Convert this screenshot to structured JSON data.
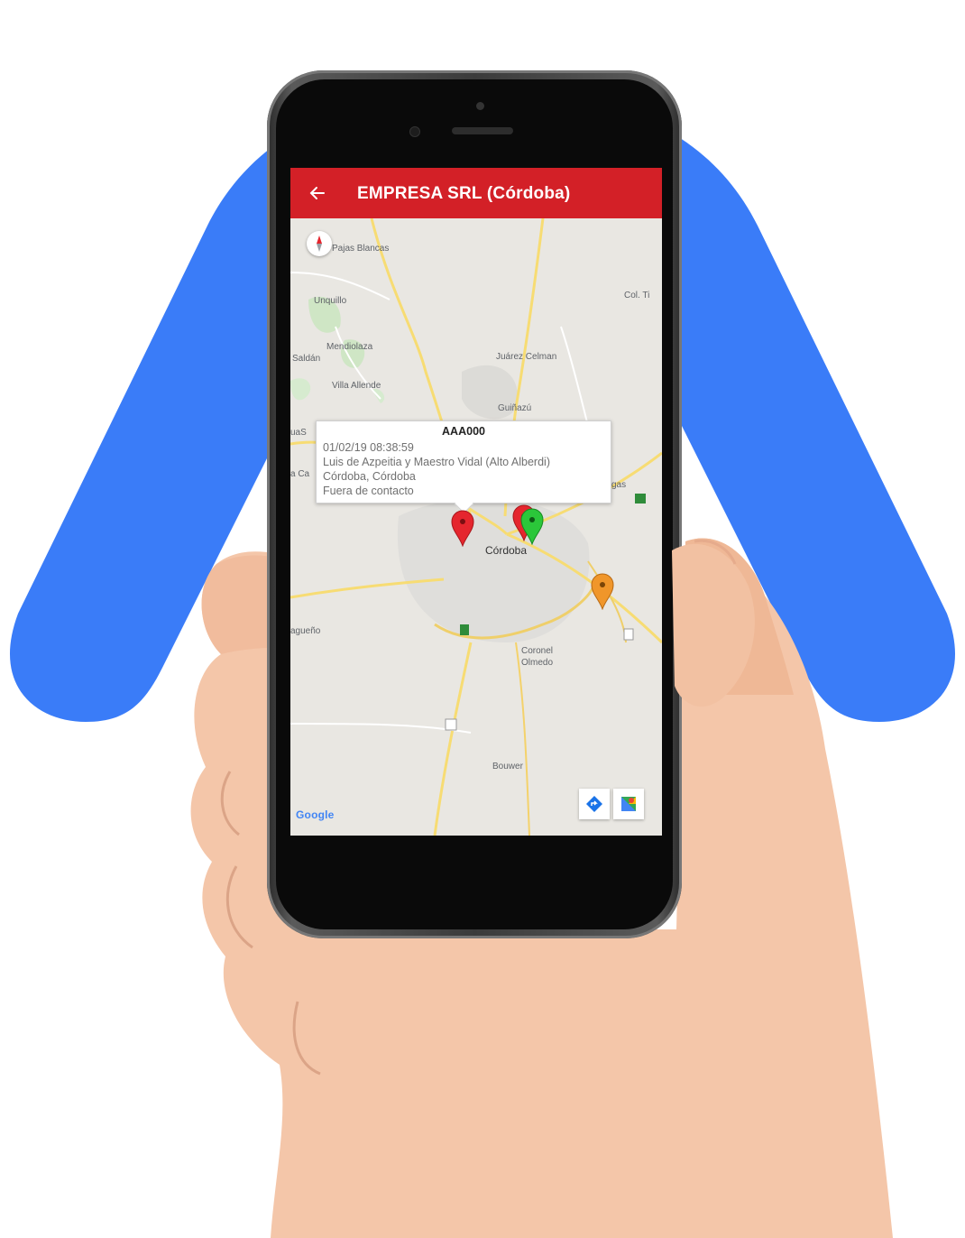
{
  "colors": {
    "brand_blue": "#3a7cf8",
    "app_bar": "#d32027",
    "map_bg": "#e9e7e2",
    "road_yellow": "#f7dc73",
    "pin_red": "#e5262e",
    "pin_green": "#2bc73a",
    "pin_orange": "#f0962a"
  },
  "app_bar": {
    "title": "EMPRESA SRL (Córdoba)",
    "back_icon": "arrow-left-icon"
  },
  "map": {
    "labels": {
      "pajas_blancas": "Pajas Blancas",
      "unquillo": "Unquillo",
      "col_tirolesa": "Col. Ti",
      "mendiolaza": "Mendiolaza",
      "saldan": "Saldán",
      "juarez_celman": "Juárez Celman",
      "villa_allende": "Villa Allende",
      "guinazu": "Guiñazú",
      "cordoba": "Córdoba",
      "coronel": "Coronel",
      "olmedo": "Olmedo",
      "bouwer": "Bouwer",
      "laguna": "agueño",
      "left_edge": "uaS",
      "left_edge2": "a Ca",
      "right_edge": "gas"
    },
    "info_window": {
      "title": "AAA000",
      "line1": "01/02/19 08:38:59",
      "line2": "Luis de Azpeitia y Maestro Vidal (Alto Alberdi)",
      "line3": "Córdoba, Córdoba",
      "line4": "Fuera de contacto"
    },
    "attribution": "Google",
    "controls": {
      "directions_icon": "directions-icon",
      "maps_icon": "google-maps-icon",
      "compass_icon": "compass-icon"
    }
  }
}
